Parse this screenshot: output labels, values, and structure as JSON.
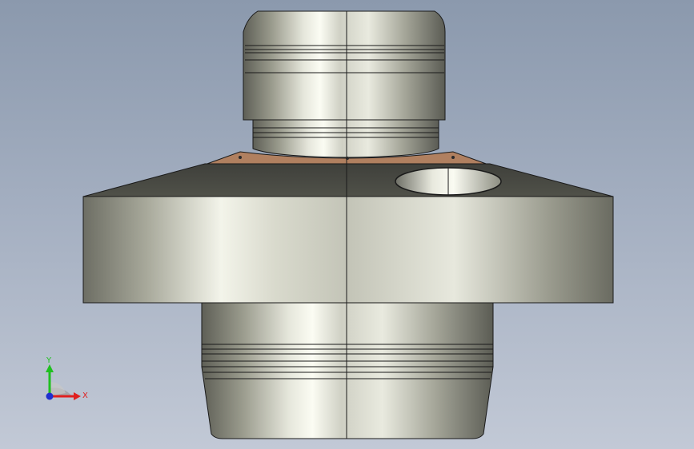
{
  "viewport": {
    "background_top": "#8b99ad",
    "background_bottom": "#c2c9d6"
  },
  "model": {
    "part_type": "stepped cylindrical fitting with flange",
    "metal_colors": {
      "dark": "#55564f",
      "mid": "#a8a99c",
      "light": "#f1f2e8"
    },
    "top_face_color": "#b08060",
    "edge_color": "#1a1a1a"
  },
  "triad": {
    "x_label": "X",
    "y_label": "Y",
    "x_color": "#e02020",
    "y_color": "#20c020",
    "z_color": "#2030d0"
  }
}
